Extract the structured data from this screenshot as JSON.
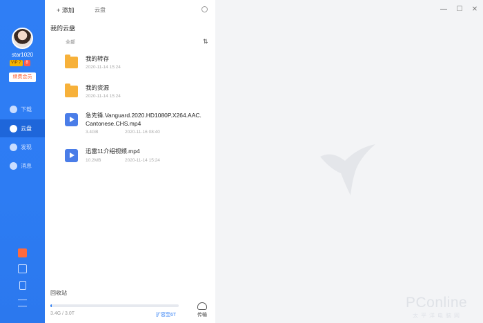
{
  "sidebar": {
    "username": "star1020",
    "vip_label": "VIP 7",
    "badge_label": "8",
    "member_button": "续费会员",
    "nav": [
      {
        "label": "下载",
        "icon": "download-icon"
      },
      {
        "label": "云盘",
        "icon": "cloud-icon"
      },
      {
        "label": "发现",
        "icon": "compass-icon"
      },
      {
        "label": "消息",
        "icon": "message-icon"
      }
    ],
    "bottom_icons": [
      "gift-icon",
      "camera-icon",
      "phone-icon",
      "menu-icon"
    ]
  },
  "toolbar": {
    "add_label": "+ 添加",
    "search_placeholder": "云盘"
  },
  "panel": {
    "title": "我的云盘",
    "filter_label": "全部",
    "files": [
      {
        "name": "我的转存",
        "date": "2020-11-14 15:24",
        "type": "folder"
      },
      {
        "name": "我的资源",
        "date": "2020-11-14 15:24",
        "type": "folder"
      },
      {
        "name_line1": "急先锋.Vanguard.2020.HD1080P.X264.AAC.",
        "name_line2": "Cantonese.CHS.mp4",
        "size": "3.4GB",
        "date": "2020-11-16 08:40",
        "type": "video"
      },
      {
        "name": "迅雷11介绍视频.mp4",
        "size": "10.2MB",
        "date": "2020-11-14 15:24",
        "type": "video"
      }
    ],
    "recycle_label": "回收站",
    "quota_text": "3.4G / 3.0T",
    "quota_fraction": 0.011,
    "expand_label": "扩容至6T",
    "transfer_label": "传输"
  },
  "window": {
    "minimize": "—",
    "maximize": "☐",
    "close": "✕"
  },
  "watermark": {
    "brand": "PConline",
    "sub": "太平洋电脑网"
  },
  "colors": {
    "accent": "#2f7ef5",
    "folder": "#f7b13a",
    "video": "#4a7de8",
    "member": "#ff5a2c"
  }
}
